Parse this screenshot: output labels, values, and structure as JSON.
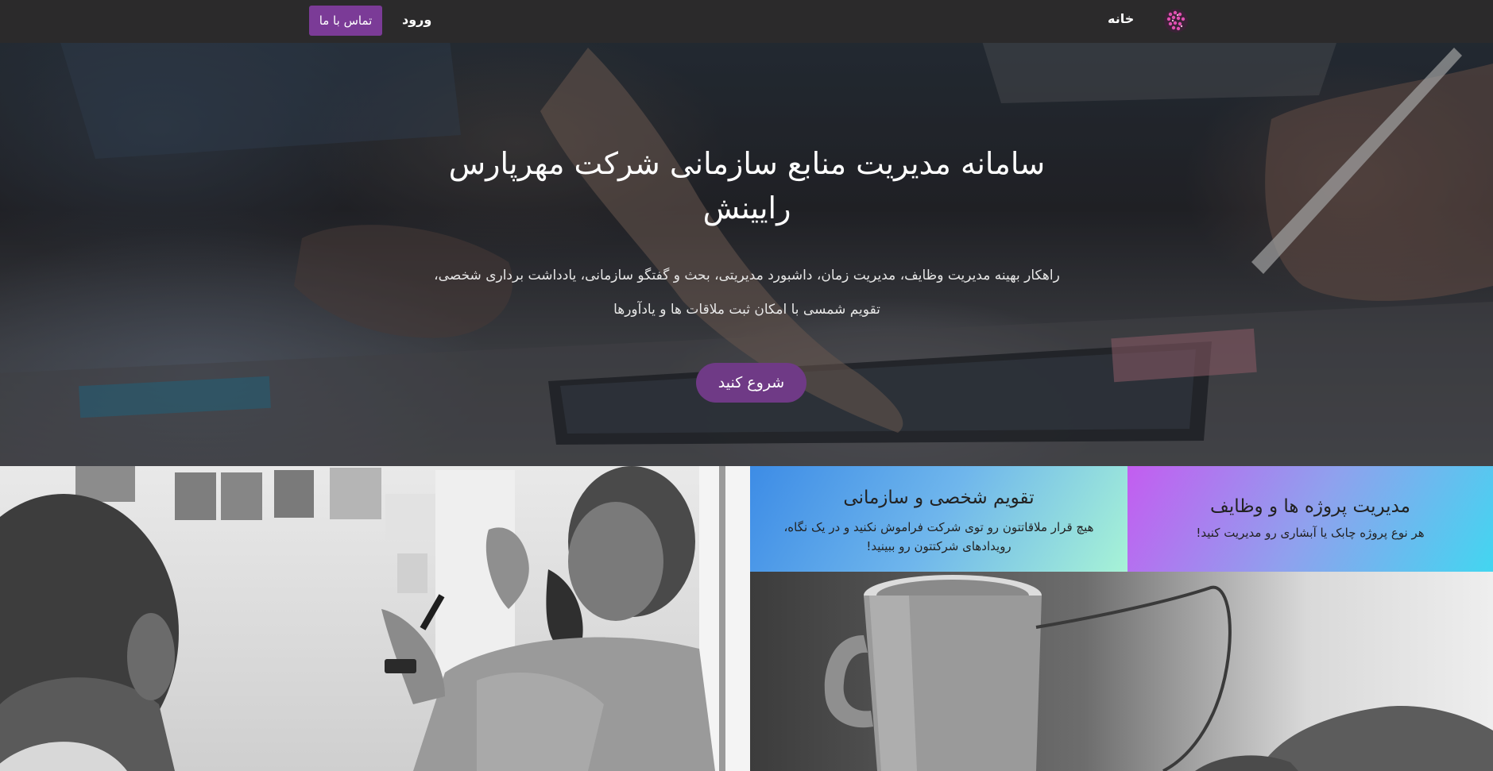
{
  "navbar": {
    "contact_label": "تماس با ما",
    "login_label": "ورود",
    "home_label": "خانه"
  },
  "hero": {
    "title": "سامانه مدیریت منابع سازمانی شرکت مهرپارس رایینش",
    "description": "راهکار بهینه مدیریت وظایف، مدیریت زمان، داشبورد مدیریتی، بحث و گفتگو سازمانی، یادداشت برداری شخصی، تقویم شمسی با امکان ثبت ملاقات ها و یادآورها",
    "start_label": "شروع کنید"
  },
  "features": {
    "calendar": {
      "title": "تقویم شخصی و سازمانی",
      "text": "هیچ قرار ملاقاتتون رو توی شرکت فراموش نکنید و در یک نگاه، رویدادهای شرکتتون رو ببینید!"
    },
    "projects": {
      "title": "مدیریت پروژه ها و وظایف",
      "text": "هر نوع پروژه چابک یا آبشاری رو مدیریت کنید!"
    }
  },
  "colors": {
    "accent": "#7b3b97",
    "navbar_bg": "#2b2a2b"
  }
}
